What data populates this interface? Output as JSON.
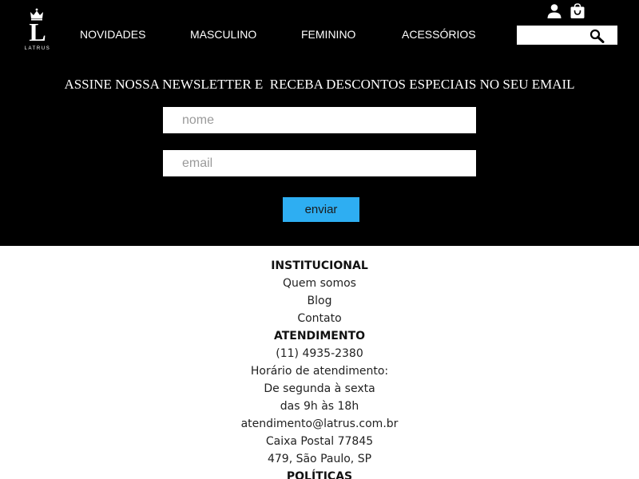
{
  "header": {
    "logo": {
      "letter": "L",
      "wordmark": "LATRUS"
    },
    "nav": [
      {
        "label": "NOVIDADES"
      },
      {
        "label": "MASCULINO"
      },
      {
        "label": "FEMININO"
      },
      {
        "label": "ACESSÓRIOS"
      }
    ],
    "icons": {
      "account": "user-icon",
      "cart": "shopping-bag-icon",
      "search": "magnifier-icon"
    },
    "search": {
      "value": "",
      "placeholder": ""
    }
  },
  "newsletter": {
    "title": "ASSINE NOSSA NEWSLETTER E  RECEBA DESCONTOS ESPECIAIS NO SEU EMAIL",
    "name_placeholder": "nome",
    "email_placeholder": "email",
    "submit_label": "enviar"
  },
  "footer": {
    "institucional": {
      "heading": "INSTITUCIONAL",
      "links": [
        "Quem somos",
        "Blog",
        "Contato"
      ]
    },
    "atendimento": {
      "heading": "ATENDIMENTO",
      "lines": [
        "(11) 4935-2380",
        "Horário de atendimento:",
        "De segunda à sexta",
        "das 9h às 18h",
        "atendimento@latrus.com.br",
        "Caixa Postal 77845",
        "479, São Paulo, SP"
      ]
    },
    "politicas": {
      "heading": "POLÍTICAS"
    }
  },
  "colors": {
    "header_bg": "#000000",
    "newsletter_bg": "#000000",
    "submit_button": "#2eaef2",
    "page_bg": "#ffffff"
  }
}
